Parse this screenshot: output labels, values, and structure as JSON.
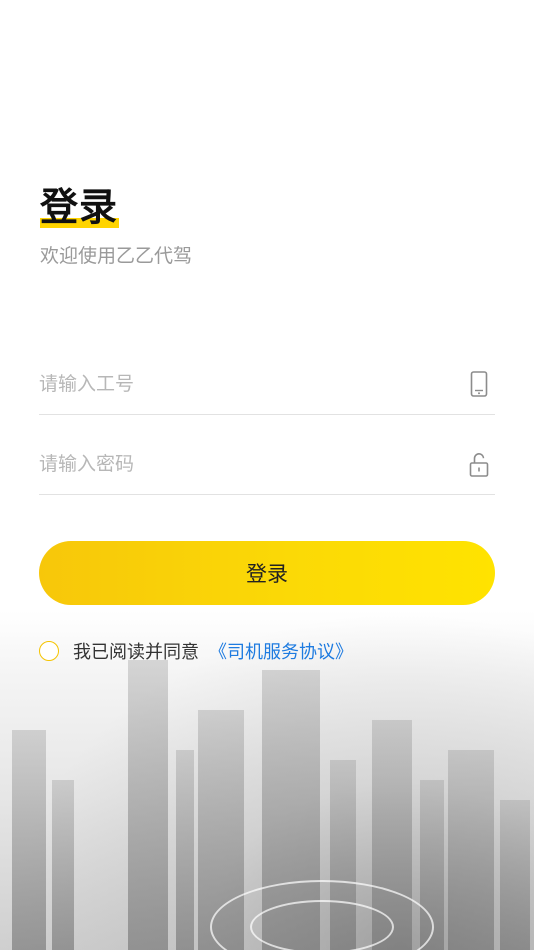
{
  "header": {
    "title": "登录",
    "subtitle": "欢迎使用乙乙代驾"
  },
  "form": {
    "employee_id": {
      "placeholder": "请输入工号",
      "value": "",
      "icon": "phone-icon"
    },
    "password": {
      "placeholder": "请输入密码",
      "value": "",
      "icon": "unlock-icon"
    },
    "login_label": "登录"
  },
  "agreement": {
    "checked": false,
    "text": "我已阅读并同意",
    "link_text": "《司机服务协议》"
  },
  "colors": {
    "accent": "#ffd400",
    "button_gradient_start": "#f7c70a",
    "button_gradient_end": "#ffe300",
    "link": "#1e7be0",
    "placeholder": "#b7b7b7",
    "subtitle": "#9a9a9a"
  },
  "background": {
    "icon": "city-skyline-image"
  }
}
